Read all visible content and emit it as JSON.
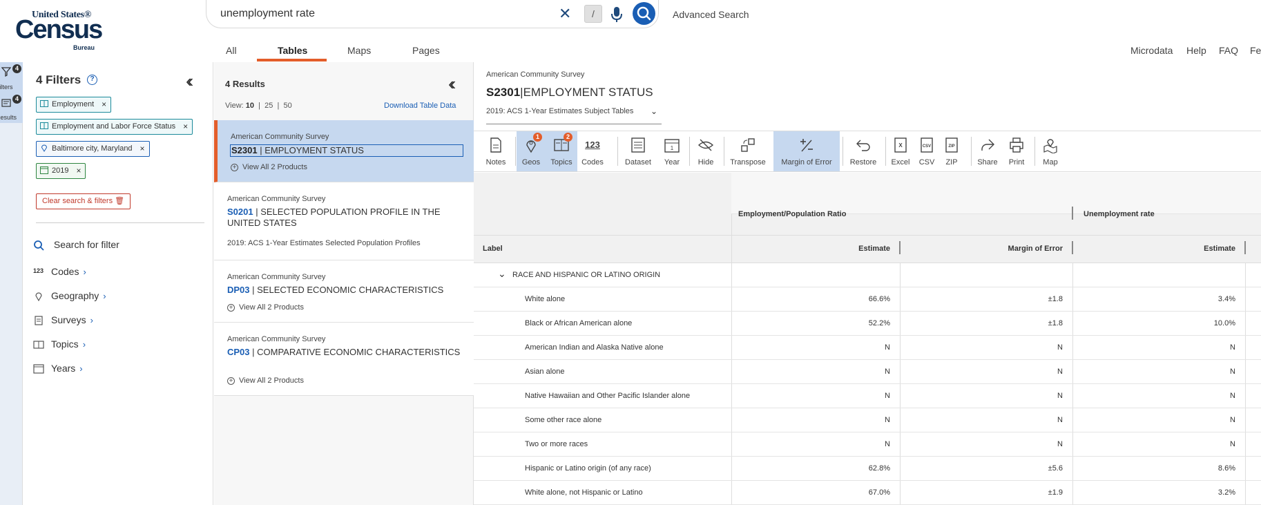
{
  "logo": {
    "line1": "United States®",
    "line2": "Census",
    "line3": "Bureau"
  },
  "search": {
    "value": "unemployment rate",
    "clear_icon": "close-icon",
    "slash_label": "/",
    "advanced_label": "Advanced Search"
  },
  "tabs": [
    {
      "label": "All"
    },
    {
      "label": "Tables"
    },
    {
      "label": "Maps"
    },
    {
      "label": "Pages"
    }
  ],
  "top_links": [
    "Microdata",
    "Help",
    "FAQ",
    "Fe"
  ],
  "rail": {
    "filters_count": "4",
    "filters_label": "Filters",
    "results_count": "4",
    "results_label": "Results"
  },
  "filters": {
    "title": "4 Filters",
    "help": "?",
    "chips": [
      {
        "label": "Employment",
        "icon": "topic-icon"
      },
      {
        "label": "Employment and Labor Force Status",
        "icon": "topic-icon"
      },
      {
        "label": "Baltimore city, Maryland",
        "icon": "location-pin-icon"
      },
      {
        "label": "2019",
        "icon": "calendar-icon"
      }
    ],
    "clear_label": "Clear search & filters",
    "search_label": "Search for filter",
    "nav": [
      {
        "label": "Codes",
        "icon": "codes-icon"
      },
      {
        "label": "Geography",
        "icon": "location-pin-icon"
      },
      {
        "label": "Surveys",
        "icon": "clipboard-icon"
      },
      {
        "label": "Topics",
        "icon": "topic-icon"
      },
      {
        "label": "Years",
        "icon": "calendar-icon"
      }
    ]
  },
  "results": {
    "title": "4 Results",
    "view_label": "View:",
    "view_options": [
      "10",
      "25",
      "50"
    ],
    "download_label": "Download Table Data",
    "items": [
      {
        "source": "American Community Survey",
        "code": "S2301",
        "name": "EMPLOYMENT STATUS",
        "sub": "View All 2 Products"
      },
      {
        "source": "American Community Survey",
        "code": "S0201",
        "name": "SELECTED POPULATION PROFILE IN THE UNITED STATES",
        "sub": "2019: ACS 1-Year Estimates Selected Population Profiles"
      },
      {
        "source": "American Community Survey",
        "code": "DP03",
        "name": "SELECTED ECONOMIC CHARACTERISTICS",
        "sub": "View All 2 Products"
      },
      {
        "source": "American Community Survey",
        "code": "CP03",
        "name": "COMPARATIVE ECONOMIC CHARACTERISTICS",
        "sub": "View All 2 Products"
      }
    ]
  },
  "table": {
    "source": "American Community Survey",
    "code": "S2301",
    "title": "EMPLOYMENT STATUS",
    "vintage": "2019: ACS 1-Year Estimates Subject Tables",
    "toolbar": [
      {
        "label": "Notes",
        "icon": "notes-icon"
      },
      {
        "label": "Geos",
        "icon": "location-pin-icon",
        "badge": "1"
      },
      {
        "label": "Topics",
        "icon": "topic-icon",
        "badge": "2"
      },
      {
        "label": "Codes",
        "icon": "codes-icon",
        "glyph": "123"
      },
      {
        "label": "Dataset",
        "icon": "dataset-icon"
      },
      {
        "label": "Year",
        "icon": "calendar-icon"
      },
      {
        "label": "Hide",
        "icon": "hide-eye-icon"
      },
      {
        "label": "Transpose",
        "icon": "transpose-icon"
      },
      {
        "label": "Margin of Error",
        "icon": "plus-minus-icon"
      },
      {
        "label": "Restore",
        "icon": "restore-icon"
      },
      {
        "label": "Excel",
        "icon": "excel-icon"
      },
      {
        "label": "CSV",
        "icon": "csv-icon"
      },
      {
        "label": "ZIP",
        "icon": "zip-icon"
      },
      {
        "label": "Share",
        "icon": "share-icon"
      },
      {
        "label": "Print",
        "icon": "print-icon"
      },
      {
        "label": "Map",
        "icon": "map-icon"
      }
    ],
    "group_headers": [
      "Employment/Population Ratio",
      "Unemployment rate"
    ],
    "col_headers": [
      "Label",
      "Estimate",
      "Margin of Error",
      "Estimate"
    ],
    "section_label": "RACE AND HISPANIC OR LATINO ORIGIN",
    "rows": [
      {
        "label": "White alone",
        "v1": "66.6%",
        "v2": "±1.8",
        "v3": "3.4%"
      },
      {
        "label": "Black or African American alone",
        "v1": "52.2%",
        "v2": "±1.8",
        "v3": "10.0%"
      },
      {
        "label": "American Indian and Alaska Native alone",
        "v1": "N",
        "v2": "N",
        "v3": "N"
      },
      {
        "label": "Asian alone",
        "v1": "N",
        "v2": "N",
        "v3": "N"
      },
      {
        "label": "Native Hawaiian and Other Pacific Islander alone",
        "v1": "N",
        "v2": "N",
        "v3": "N"
      },
      {
        "label": "Some other race alone",
        "v1": "N",
        "v2": "N",
        "v3": "N"
      },
      {
        "label": "Two or more races",
        "v1": "N",
        "v2": "N",
        "v3": "N"
      },
      {
        "label": "Hispanic or Latino origin (of any race)",
        "v1": "62.8%",
        "v2": "±5.6",
        "v3": "8.6%"
      },
      {
        "label": "White alone, not Hispanic or Latino",
        "v1": "67.0%",
        "v2": "±1.9",
        "v3": "3.2%"
      }
    ]
  },
  "colors": {
    "accent": "#e35d2a",
    "link": "#1a5eb4",
    "selected": "#c6d8ef",
    "brand": "#112e51"
  }
}
